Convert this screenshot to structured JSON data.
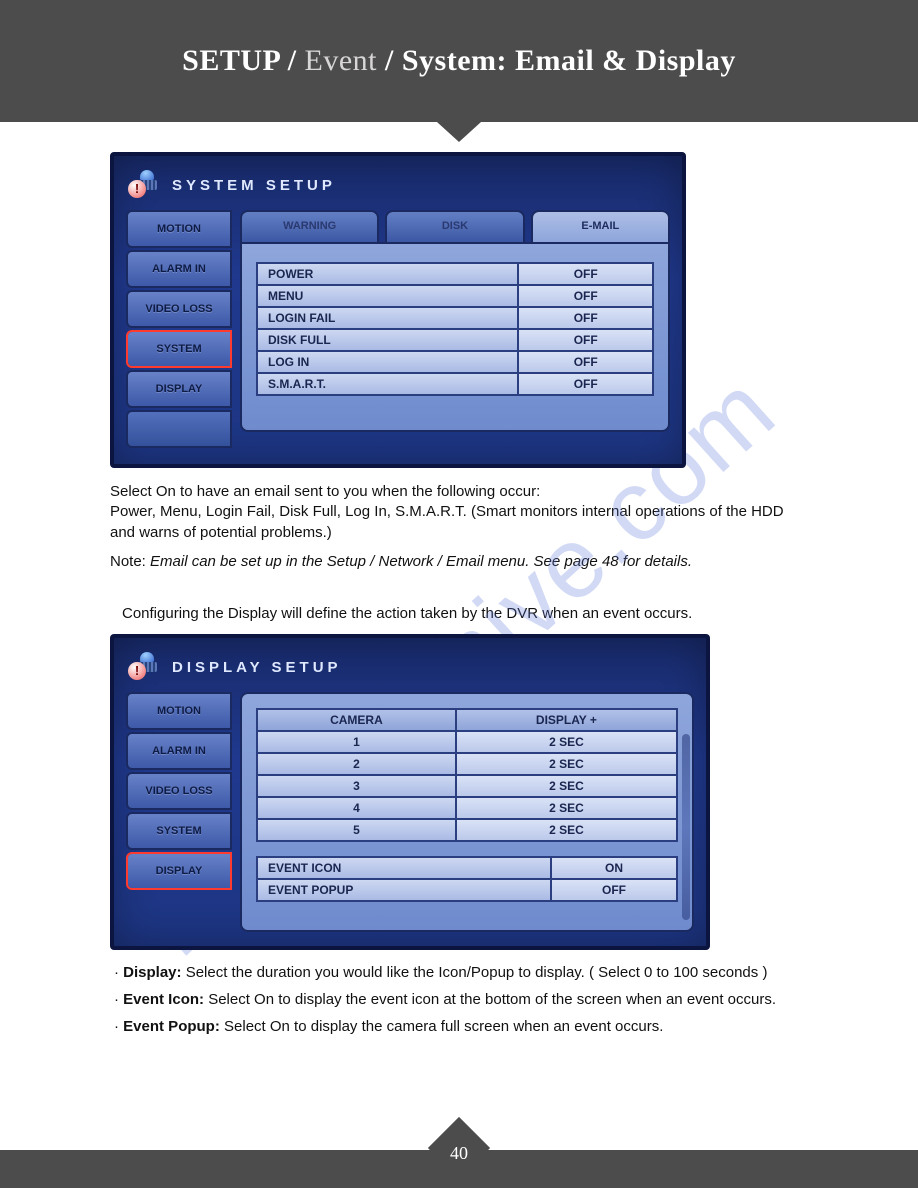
{
  "header": {
    "part1": "SETUP",
    "sep": " / ",
    "part2": "Event",
    "part3": "System: Email & Display"
  },
  "watermark": "manualshive.com",
  "panel1": {
    "title": "SYSTEM SETUP",
    "sideTabs": [
      "MOTION",
      "ALARM IN",
      "VIDEO LOSS",
      "SYSTEM",
      "DISPLAY",
      ""
    ],
    "selectedSide": "SYSTEM",
    "topTabs": [
      "WARNING",
      "DISK",
      "E-MAIL"
    ],
    "activeTop": "E-MAIL",
    "rows": [
      {
        "label": "POWER",
        "value": "OFF"
      },
      {
        "label": "MENU",
        "value": "OFF"
      },
      {
        "label": "LOGIN FAIL",
        "value": "OFF"
      },
      {
        "label": "DISK FULL",
        "value": "OFF"
      },
      {
        "label": "LOG IN",
        "value": "OFF"
      },
      {
        "label": "S.M.A.R.T.",
        "value": "OFF"
      }
    ]
  },
  "text1": {
    "p": "Select On to have an email sent to you when the following occur:\nPower, Menu, Login Fail, Disk Full, Log In, S.M.A.R.T. (Smart monitors internal operations of the HDD and warns of potential problems.)",
    "noteLabel": "Note: ",
    "noteBody": "Email can be set up in the Setup / Network / Email menu. See page 48 for details."
  },
  "text2": {
    "intro": "Configuring the Display will define the action taken by the DVR when an event occurs."
  },
  "panel2": {
    "title": "DISPLAY SETUP",
    "sideTabs": [
      "MOTION",
      "ALARM IN",
      "VIDEO LOSS",
      "SYSTEM",
      "DISPLAY"
    ],
    "selectedSide": "DISPLAY",
    "headers": [
      "CAMERA",
      "DISPLAY +"
    ],
    "rows": [
      {
        "camera": "1",
        "display": "2 SEC"
      },
      {
        "camera": "2",
        "display": "2 SEC"
      },
      {
        "camera": "3",
        "display": "2 SEC"
      },
      {
        "camera": "4",
        "display": "2 SEC"
      },
      {
        "camera": "5",
        "display": "2 SEC"
      }
    ],
    "extraRows": [
      {
        "label": "EVENT ICON",
        "value": "ON"
      },
      {
        "label": "EVENT POPUP",
        "value": "OFF"
      }
    ]
  },
  "bullets": [
    {
      "label": "Display:",
      "text": " Select the duration you would like the Icon/Popup to display. ( Select 0 to 100 seconds )"
    },
    {
      "label": "Event Icon:",
      "text": " Select On to display the event icon at the bottom of the screen when an event occurs."
    },
    {
      "label": "Event Popup:",
      "text": " Select On to display the camera full screen when an event occurs."
    }
  ],
  "pageNumber": "40"
}
